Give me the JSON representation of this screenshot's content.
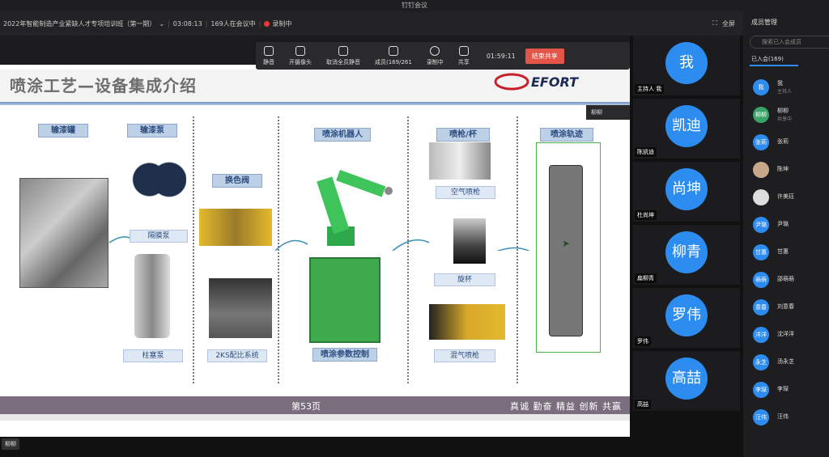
{
  "window_title": "钉钉会议",
  "meeting": {
    "name": "2022年智能制造产业紧缺人才专项培训班（第一期）",
    "elapsed": "03:08:13",
    "attendees": "169人在会议中",
    "recording": "录制中",
    "fullscreen": "全屏"
  },
  "controls": {
    "mute": "静音",
    "camera": "开摄像头",
    "mute_all": "取消全员静音",
    "members": "成员(169/261",
    "record": "录制中",
    "share": "共享",
    "time": "01:59:11",
    "end_share": "结束共享"
  },
  "slide": {
    "title": "喷涂工艺—设备集成介绍",
    "logo": "EFORT",
    "page": "第53页",
    "motto": "真诚 勤奋 精益 创新 共赢",
    "labels": {
      "tank": "输漆罐",
      "pump": "输漆泵",
      "valve": "换色阀",
      "robot": "喷涂机器人",
      "gun": "喷枪/杯",
      "track": "喷涂轨迹",
      "diaphragm": "隔膜泵",
      "plunger": "柱塞泵",
      "ks": "2KS配比系统",
      "param": "喷涂参数控制",
      "air_gun": "空气喷枪",
      "bell": "旋杯",
      "mixed_gun": "混气喷枪"
    },
    "sharer": "柳柳"
  },
  "video_tiles": [
    {
      "avatar": "我",
      "name": "我",
      "tag": "主持人"
    },
    {
      "avatar": "凯迪",
      "name": "陈凯迪"
    },
    {
      "avatar": "尚坤",
      "name": "杜尚坤"
    },
    {
      "avatar": "柳青",
      "name": "扁柳青"
    },
    {
      "avatar": "罗伟",
      "name": "罗伟"
    },
    {
      "avatar": "高喆",
      "name": "高喆"
    }
  ],
  "sidebar": {
    "title": "成员管理",
    "search_placeholder": "搜索已入会成员",
    "tab": "已入会(169)",
    "members": [
      {
        "avatar": "我",
        "name": "我",
        "role": "主持人"
      },
      {
        "avatar": "柳柳",
        "name": "柳柳",
        "role": "共享中"
      },
      {
        "avatar": "张莉",
        "name": "张莉",
        "role": ""
      },
      {
        "avatar": "",
        "name": "陈坤",
        "role": ""
      },
      {
        "avatar": "",
        "name": "许美珏",
        "role": ""
      },
      {
        "avatar": "尹璐",
        "name": "尹璐",
        "role": ""
      },
      {
        "avatar": "甘惠",
        "name": "甘惠",
        "role": ""
      },
      {
        "avatar": "萌萌",
        "name": "邵萌萌",
        "role": ""
      },
      {
        "avatar": "意春",
        "name": "刘意春",
        "role": ""
      },
      {
        "avatar": "洋洋",
        "name": "沈洋洋",
        "role": ""
      },
      {
        "avatar": "永芝",
        "name": "汤永芝",
        "role": ""
      },
      {
        "avatar": "李琛",
        "name": "李琛",
        "role": ""
      },
      {
        "avatar": "汪伟",
        "name": "汪伟",
        "role": ""
      }
    ]
  },
  "speaker": "柳柳",
  "colors": {
    "accent": "#2d8cf0",
    "end": "#e45448",
    "record": "#e23b3b"
  }
}
